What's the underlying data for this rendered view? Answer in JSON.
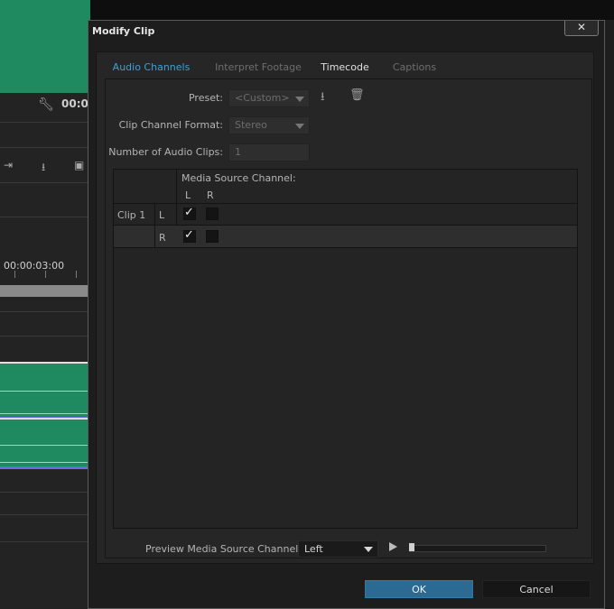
{
  "background": {
    "timecode_top": "00:0",
    "ruler_timecode": "00:00:03:00"
  },
  "dialog": {
    "title": "Modify Clip",
    "close_label": "✕",
    "tabs": [
      {
        "label": "Audio Channels",
        "state": "active"
      },
      {
        "label": "Interpret Footage",
        "state": "inactive"
      },
      {
        "label": "Timecode",
        "state": "inactive"
      },
      {
        "label": "Captions",
        "state": "inactive"
      }
    ],
    "preset": {
      "label": "Preset:",
      "value": "<Custom>"
    },
    "clip_channel_format": {
      "label": "Clip Channel Format:",
      "value": "Stereo"
    },
    "number_of_audio_clips": {
      "label": "Number of Audio Clips:",
      "value": "1"
    },
    "table": {
      "header": "Media Source Channel:",
      "columns": [
        "L",
        "R"
      ],
      "clip_label": "Clip 1",
      "rows": [
        {
          "channel": "L",
          "L": true,
          "R": false
        },
        {
          "channel": "R",
          "L": true,
          "R": false
        }
      ]
    },
    "preview": {
      "label": "Preview Media Source Channel:",
      "value": "Left",
      "progress": 0
    },
    "buttons": {
      "ok": "OK",
      "cancel": "Cancel"
    }
  },
  "colors": {
    "accent": "#3ea0d8",
    "ok_button": "#2a6a93",
    "clip_green": "#1f8a60"
  }
}
